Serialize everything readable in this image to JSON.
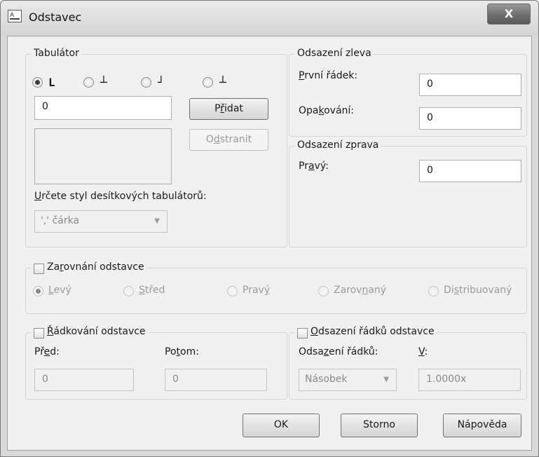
{
  "window": {
    "title": "Odstavec",
    "close_glyph": "X"
  },
  "tabulator": {
    "label": "Tabulátor",
    "glyphs": [
      "L",
      "┴",
      "┘",
      "┴"
    ],
    "input_value": "0",
    "add_pre": "P",
    "add_u": "ř",
    "add_post": "idat",
    "remove_pre": "O",
    "remove_u": "d",
    "remove_post": "stranit",
    "decimal_label_u": "U",
    "decimal_label_rest": "rčete styl desítkových tabulátorů:",
    "decimal_value": "',' čárka"
  },
  "left_indent": {
    "label": "Odsazení zleva",
    "first_u": "P",
    "first_rest": "rvní řádek:",
    "first_value": "0",
    "hang_pre": "Opa",
    "hang_u": "k",
    "hang_post": "ování:",
    "hang_value": "0"
  },
  "right_indent": {
    "label": "Odsazení zprava",
    "right_pre": "Pr",
    "right_u": "a",
    "right_post": "vý:",
    "right_value": "0"
  },
  "alignment": {
    "label_pre": "Za",
    "label_u": "r",
    "label_post": "ovnání odstavce",
    "left_u": "L",
    "left_rest": "evý",
    "center_u": "S",
    "center_rest": "třed",
    "right_pre": "Prav",
    "right_u": "ý",
    "justify_pre": "Zarov",
    "justify_u": "n",
    "justify_post": "aný",
    "dist_pre": "Di",
    "dist_u": "s",
    "dist_post": "tribuovaný"
  },
  "line_spacing": {
    "label_u": "Ř",
    "label_rest": "ádkování odstavce",
    "before_pre": "Př",
    "before_u": "e",
    "before_post": "d:",
    "before_value": "0",
    "after_pre": "Po",
    "after_u": "t",
    "after_post": "om:",
    "after_value": "0"
  },
  "line_offset": {
    "label_u": "O",
    "label_rest": "dsazení řádků odstavce",
    "type_pre": "Odsa",
    "type_u": "z",
    "type_post": "ení řádků:",
    "type_value": "Násobek",
    "v_u": "V",
    "v_rest": ":",
    "v_value": "1.0000x"
  },
  "buttons": {
    "ok": "OK",
    "cancel": "Storno",
    "help": "Nápověda"
  },
  "colors": {
    "dialog_bg": "#f0f0f0",
    "frame": "#d9d9d9",
    "disabled_text": "#9a9a9a"
  }
}
